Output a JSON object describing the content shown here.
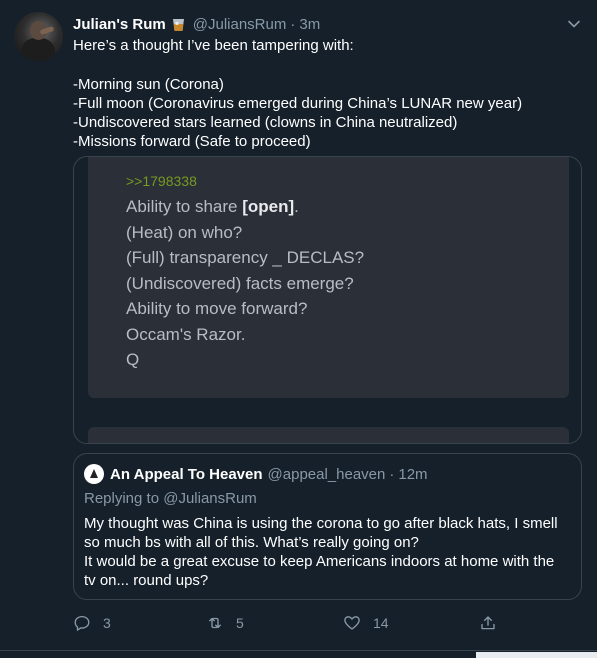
{
  "tweet": {
    "author_name": "Julian's Rum",
    "author_emoji": "tumbler-glass-icon",
    "handle": "@JuliansRum",
    "separator": "·",
    "time": "3m",
    "lines": [
      "Here’s a thought I’ve been tampering with:",
      "",
      "-Morning sun (Corona)",
      "-Full moon (Coronavirus emerged during China’s LUNAR new year)",
      "-Undiscovered stars learned (clowns in China neutralized)",
      "-Missions forward (Safe to proceed)"
    ]
  },
  "card": {
    "link": ">>1798338",
    "line1_a": "Ability to share ",
    "line1_b": "[open]",
    "line1_c": ".",
    "lines": [
      "(Heat) on who?",
      "(Full) transparency _ DECLAS?",
      "(Undiscovered) facts emerge?",
      "Ability to move forward?",
      "Occam's Razor.",
      "Q"
    ]
  },
  "quote": {
    "name": "An Appeal To Heaven",
    "handle": "@appeal_heaven",
    "separator": "·",
    "time": "12m",
    "replying": "Replying to @JuliansRum",
    "lines": [
      "My thought was China is using the corona to go after black hats, I smell",
      "so much bs with all of this. What’s really going on?",
      "It would be a great excuse to keep Americans indoors at home with the",
      "tv on... round ups?"
    ]
  },
  "actions": {
    "replies": "3",
    "retweets": "5",
    "likes": "14"
  },
  "colors": {
    "background": "#15202b",
    "border": "#38444d",
    "secondary_text": "#8899a6",
    "quote_link": "#789922"
  }
}
